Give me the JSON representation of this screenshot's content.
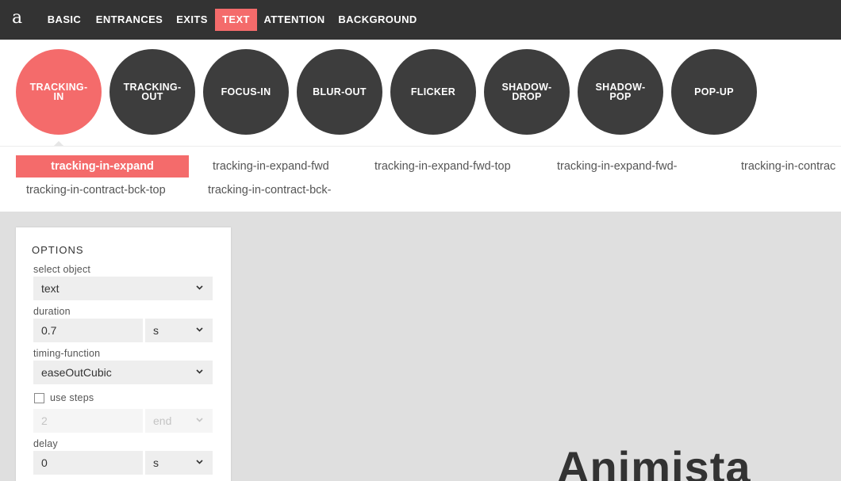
{
  "nav": {
    "logo": "a",
    "tabs": [
      {
        "label": "BASIC"
      },
      {
        "label": "ENTRANCES"
      },
      {
        "label": "EXITS"
      },
      {
        "label": "TEXT"
      },
      {
        "label": "ATTENTION"
      },
      {
        "label": "BACKGROUND"
      }
    ],
    "active_tab": "TEXT"
  },
  "animations": [
    {
      "label": "TRACKING-IN"
    },
    {
      "label": "TRACKING-OUT"
    },
    {
      "label": "FOCUS-IN"
    },
    {
      "label": "BLUR-OUT"
    },
    {
      "label": "FLICKER"
    },
    {
      "label": "SHADOW-DROP"
    },
    {
      "label": "SHADOW-POP"
    },
    {
      "label": "POP-UP"
    }
  ],
  "active_animation": "TRACKING-IN",
  "variants": [
    {
      "label": "tracking-in-expand"
    },
    {
      "label": "tracking-in-expand-fwd"
    },
    {
      "label": "tracking-in-expand-fwd-top"
    },
    {
      "label": "tracking-in-expand-fwd-"
    },
    {
      "label": "tracking-in-contrac"
    },
    {
      "label": "tracking-in-contract-bck-top"
    },
    {
      "label": "tracking-in-contract-bck-"
    }
  ],
  "active_variant": "tracking-in-expand",
  "options": {
    "title": "OPTIONS",
    "select_object": {
      "label": "select object",
      "value": "text"
    },
    "duration": {
      "label": "duration",
      "value": "0.7",
      "unit": "s"
    },
    "timing_function": {
      "label": "timing-function",
      "value": "easeOutCubic"
    },
    "use_steps": {
      "label": "use steps",
      "checked": false,
      "steps_value": "2",
      "steps_position": "end"
    },
    "delay": {
      "label": "delay",
      "value": "0",
      "unit": "s"
    }
  },
  "preview": {
    "text": "Animista"
  },
  "colors": {
    "accent": "#f46b6b",
    "nav_bg": "#333333",
    "circle_bg": "#3d3d3d",
    "canvas_bg": "#dfdfdf"
  },
  "icons": {
    "dropdown": "chevron-down-icon"
  }
}
